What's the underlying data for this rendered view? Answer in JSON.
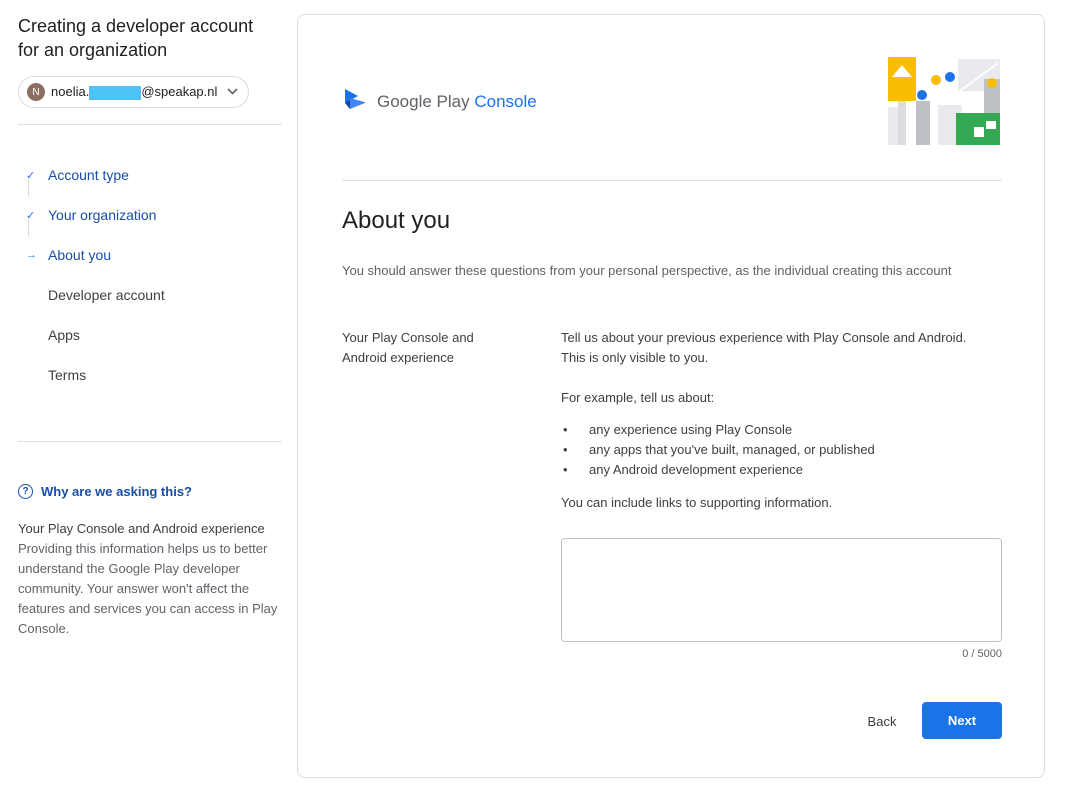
{
  "sidebar": {
    "title": "Creating a developer account for an organization",
    "account": {
      "avatar_letter": "N",
      "email_prefix": "noelia.",
      "email_suffix": "@speakap.nl"
    },
    "steps": [
      {
        "label": "Account type",
        "state": "done",
        "mark": "✓"
      },
      {
        "label": "Your organization",
        "state": "done",
        "mark": "✓"
      },
      {
        "label": "About you",
        "state": "current",
        "mark": "→"
      },
      {
        "label": "Developer account",
        "state": "todo"
      },
      {
        "label": "Apps",
        "state": "todo"
      },
      {
        "label": "Terms",
        "state": "todo"
      }
    ],
    "help": {
      "icon": "help-circle-icon",
      "title": "Why are we asking this?",
      "subtitle": "Your Play Console and Android experience",
      "body": "Providing this information helps us to better understand the Google Play developer community. Your answer won't affect the features and services you can access in Play Console."
    }
  },
  "main": {
    "logo": {
      "brand": "Google Play",
      "product": "Console"
    },
    "heading": "About you",
    "intro": "You should answer these questions from your personal perspective, as the individual creating this account",
    "field": {
      "label": "Your Play Console and Android experience",
      "description": "Tell us about your previous experience with Play Console and Android. This is only visible to you.",
      "example_intro": "For example, tell us about:",
      "examples": [
        "any experience using Play Console",
        "any apps that you've built, managed, or published",
        "any Android development experience"
      ],
      "links_note": "You can include links to supporting information.",
      "value": "",
      "counter": "0 / 5000"
    },
    "buttons": {
      "back": "Back",
      "next": "Next"
    }
  },
  "colors": {
    "accent": "#1a73e8",
    "link": "#174ea6",
    "redaction": "#4fc3f7"
  }
}
